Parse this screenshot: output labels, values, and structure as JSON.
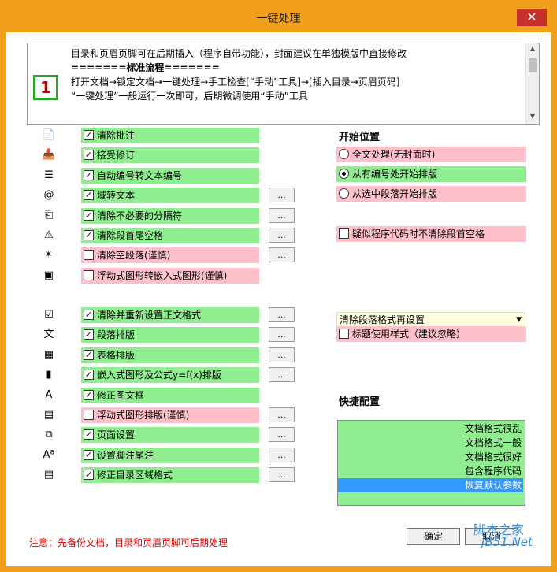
{
  "window": {
    "title": "一键处理",
    "close_glyph": "✕"
  },
  "info": {
    "lines": [
      "目录和页眉页脚可在后期插入（程序自带功能），封面建议在单独模版中直接修改",
      "=======标准流程=======",
      "打开文档→锁定文档→一键处理→手工检查[“手动”工具]→[插入目录→页眉页码]",
      "“一键处理”一般运行一次即可，后期微调使用“手动”工具"
    ],
    "step_badge": "1"
  },
  "options_group1": [
    {
      "label": "清除批注",
      "checked": true,
      "color": "green",
      "icon": "document-star-icon",
      "icon_glyph": "📄",
      "has_more": false
    },
    {
      "label": "接受修订",
      "checked": true,
      "color": "green",
      "icon": "accept-revision-icon",
      "icon_glyph": "📥",
      "has_more": false
    },
    {
      "label": "自动编号转文本编号",
      "checked": true,
      "color": "green",
      "icon": "numbered-list-icon",
      "icon_glyph": "☰",
      "has_more": false
    },
    {
      "label": "域转文本",
      "checked": true,
      "color": "green",
      "icon": "field-icon",
      "icon_glyph": "@",
      "has_more": true
    },
    {
      "label": "清除不必要的分隔符",
      "checked": true,
      "color": "green",
      "icon": "section-break-icon",
      "icon_glyph": "⎗",
      "has_more": true
    },
    {
      "label": "清除段首尾空格",
      "checked": true,
      "color": "green",
      "icon": "warning-icon",
      "icon_glyph": "⚠",
      "has_more": true
    },
    {
      "label": "清除空段落(谨慎)",
      "checked": false,
      "color": "pink",
      "icon": "new-document-icon",
      "icon_glyph": "✴",
      "has_more": true
    },
    {
      "label": "浮动式图形转嵌入式图形(谨慎)",
      "checked": false,
      "color": "pink",
      "icon": "image-convert-icon",
      "icon_glyph": "▣",
      "has_more": false
    }
  ],
  "options_group2": [
    {
      "label": "清除并重新设置正文格式",
      "checked": true,
      "color": "green",
      "icon": "checkmark-box-icon",
      "icon_glyph": "☑",
      "has_more": true
    },
    {
      "label": "段落排版",
      "checked": true,
      "color": "green",
      "icon": "paragraph-icon",
      "icon_glyph": "文",
      "has_more": true
    },
    {
      "label": "表格排版",
      "checked": true,
      "color": "green",
      "icon": "table-icon",
      "icon_glyph": "▦",
      "has_more": true
    },
    {
      "label": "嵌入式图形及公式y=f(x)排版",
      "checked": true,
      "color": "green",
      "icon": "chart-icon",
      "icon_glyph": "▮",
      "has_more": true
    },
    {
      "label": "修正图文框",
      "checked": true,
      "color": "green",
      "icon": "text-frame-icon",
      "icon_glyph": "A",
      "has_more": false
    },
    {
      "label": "浮动式图形排版(谨慎)",
      "checked": false,
      "color": "pink",
      "icon": "floating-image-icon",
      "icon_glyph": "▤",
      "has_more": true
    },
    {
      "label": "页面设置",
      "checked": true,
      "color": "green",
      "icon": "page-setup-icon",
      "icon_glyph": "⧉",
      "has_more": true
    },
    {
      "label": "设置脚注尾注",
      "checked": true,
      "color": "green",
      "icon": "footnote-icon",
      "icon_glyph": "Aª",
      "has_more": true
    },
    {
      "label": "修正目录区域格式",
      "checked": true,
      "color": "green",
      "icon": "toc-icon",
      "icon_glyph": "▤",
      "has_more": true
    }
  ],
  "start_position": {
    "title": "开始位置",
    "options": [
      {
        "label": "全文处理(无封面时)",
        "selected": false,
        "color": "pink"
      },
      {
        "label": "从有编号处开始排版",
        "selected": true,
        "color": "green"
      },
      {
        "label": "从选中段落开始排版",
        "selected": false,
        "color": "pink"
      }
    ],
    "code_option": {
      "label": "疑似程序代码时不清除段首空格",
      "checked": false,
      "color": "pink"
    }
  },
  "format": {
    "dropdown_value": "清除段落格式再设置",
    "heading_option": {
      "label": "标题使用样式（建议忽略）",
      "checked": false,
      "color": "pink"
    }
  },
  "quick_config": {
    "title": "快捷配置",
    "items": [
      "文档格式很乱",
      "文档格式一般",
      "文档格式很好",
      "包含程序代码",
      "恢复默认参数"
    ],
    "selected_index": 4
  },
  "footer": {
    "warning": "注意：先备份文档，目录和页眉页脚可后期处理",
    "ok_label": "确定",
    "cancel_label": "取消"
  },
  "watermark": {
    "line1": "脚本之家",
    "line2": "JB51.Net"
  },
  "more_label": "..."
}
